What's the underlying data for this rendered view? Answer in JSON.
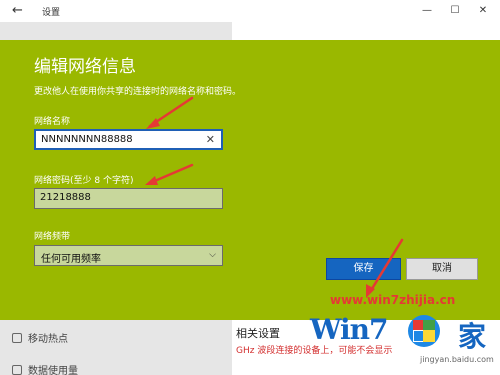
{
  "window": {
    "back_glyph": "←",
    "title": "设置",
    "minimize_glyph": "—",
    "maximize_glyph": "☐",
    "close_glyph": "✕"
  },
  "background": {
    "sidebar_items": [
      {
        "label": "移动热点"
      },
      {
        "label": "数据使用量"
      }
    ],
    "content_heading": "相关设置",
    "content_red_text": "GHz 波段连接的设备上，可能不会显示"
  },
  "dialog": {
    "title": "编辑网络信息",
    "description": "更改他人在使用你共享的连接时的网络名称和密码。",
    "network_name": {
      "label": "网络名称",
      "value": "NNNNNNNN88888",
      "clear_glyph": "✕"
    },
    "network_password": {
      "label": "网络密码(至少 8 个字符)",
      "value": "21218888"
    },
    "network_band": {
      "label": "网络频带",
      "selected": "任何可用频率",
      "chevron": "⌵"
    },
    "save_label": "保存",
    "cancel_label": "取消"
  },
  "watermark": {
    "url": "www.win7zhijia.cn",
    "logo_text": "Win7",
    "logo_suffix": "家",
    "site": "jingyan.baidu.com"
  },
  "colors": {
    "dialog_bg": "#9ab800",
    "accent": "#1565c0",
    "annotation": "#e53935"
  }
}
